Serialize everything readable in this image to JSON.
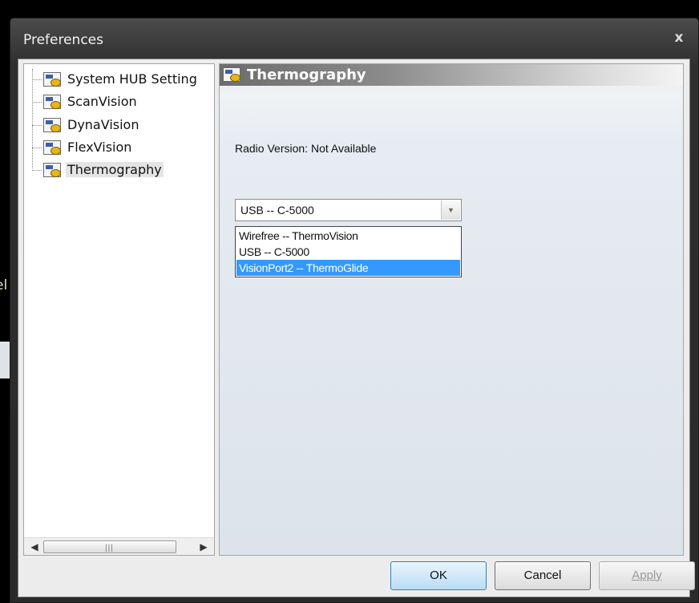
{
  "window": {
    "title": "Preferences",
    "close_glyph": "x"
  },
  "background": {
    "edge_text": "el"
  },
  "tree": {
    "items": [
      {
        "label": "System HUB Setting",
        "icon": "settings-node-icon"
      },
      {
        "label": "ScanVision",
        "icon": "settings-node-icon"
      },
      {
        "label": "DynaVision",
        "icon": "settings-node-icon"
      },
      {
        "label": "FlexVision",
        "icon": "settings-node-icon"
      },
      {
        "label": "Thermography",
        "icon": "settings-node-icon",
        "selected": true
      }
    ],
    "scroll_left": "◀",
    "scroll_right": "▶",
    "scroll_grip": "|||"
  },
  "panel": {
    "title": "Thermography",
    "radio_version_label": "Radio Version:",
    "radio_version_value": "Not Available",
    "combo": {
      "value": "USB -- C-5000",
      "arrow": "▼",
      "options": [
        "Wirefree -- ThermoVision",
        "USB -- C-5000",
        "VisionPort2 -- ThermoGlide"
      ],
      "highlighted": "VisionPort2 -- ThermoGlide"
    }
  },
  "buttons": {
    "ok": "OK",
    "cancel": "Cancel",
    "apply": "Apply"
  }
}
